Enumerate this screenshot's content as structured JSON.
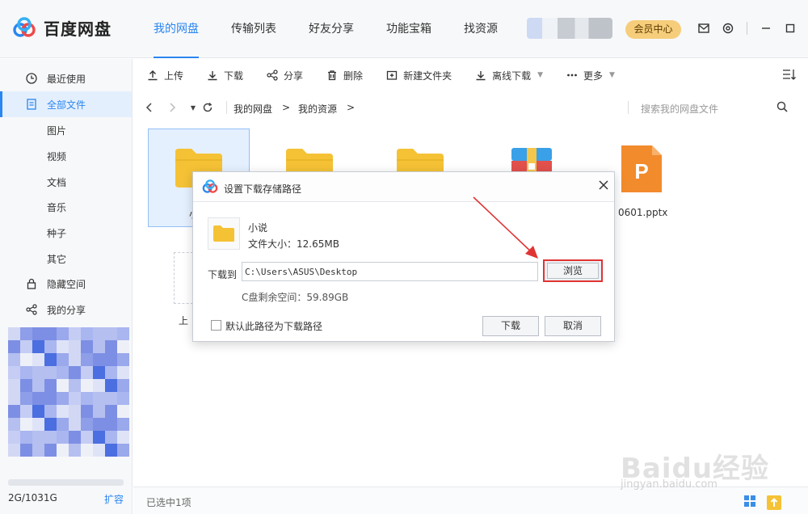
{
  "app": {
    "name": "百度网盘"
  },
  "nav": {
    "tabs": [
      {
        "label": "我的网盘"
      },
      {
        "label": "传输列表"
      },
      {
        "label": "好友分享"
      },
      {
        "label": "功能宝箱"
      },
      {
        "label": "找资源"
      }
    ]
  },
  "header": {
    "vip_label": "会员中心"
  },
  "sidebar": {
    "items": [
      {
        "label": "最近使用"
      },
      {
        "label": "全部文件"
      }
    ],
    "sub_items": [
      {
        "label": "图片"
      },
      {
        "label": "视频"
      },
      {
        "label": "文档"
      },
      {
        "label": "音乐"
      },
      {
        "label": "种子"
      },
      {
        "label": "其它"
      }
    ],
    "bottom_items": [
      {
        "label": "隐藏空间"
      },
      {
        "label": "我的分享"
      }
    ],
    "quota": "2G/1031G",
    "expand_label": "扩容"
  },
  "toolbar": {
    "upload": "上传",
    "download": "下载",
    "share": "分享",
    "delete": "删除",
    "new_folder": "新建文件夹",
    "offline_download": "离线下载",
    "more": "更多"
  },
  "pathbar": {
    "crumbs": [
      {
        "label": "我的网盘"
      },
      {
        "label": "我的资源"
      }
    ],
    "search_placeholder": "搜索我的网盘文件"
  },
  "files": {
    "selected_partial": "小",
    "pptx_name": "0601.pptx",
    "upload_partial": "上"
  },
  "status": {
    "selection": "已选中1项"
  },
  "dialog": {
    "title": "设置下载存储路径",
    "file_name": "小说",
    "file_size": "文件大小：12.65MB",
    "download_to_label": "下载到",
    "path_value": "C:\\Users\\ASUS\\Desktop",
    "browse": "浏览",
    "free_space": "C盘剩余空间：59.89GB",
    "default_path_label": "默认此路径为下载路径",
    "download_button": "下载",
    "cancel_button": "取消"
  },
  "watermark": {
    "text": "Baidu经验",
    "url": "jingyan.baidu.com"
  },
  "colors": {
    "accent": "#2a86f0",
    "folder": "#f5c236",
    "highlight": "#e03434",
    "vip": "#f6cd7a"
  }
}
